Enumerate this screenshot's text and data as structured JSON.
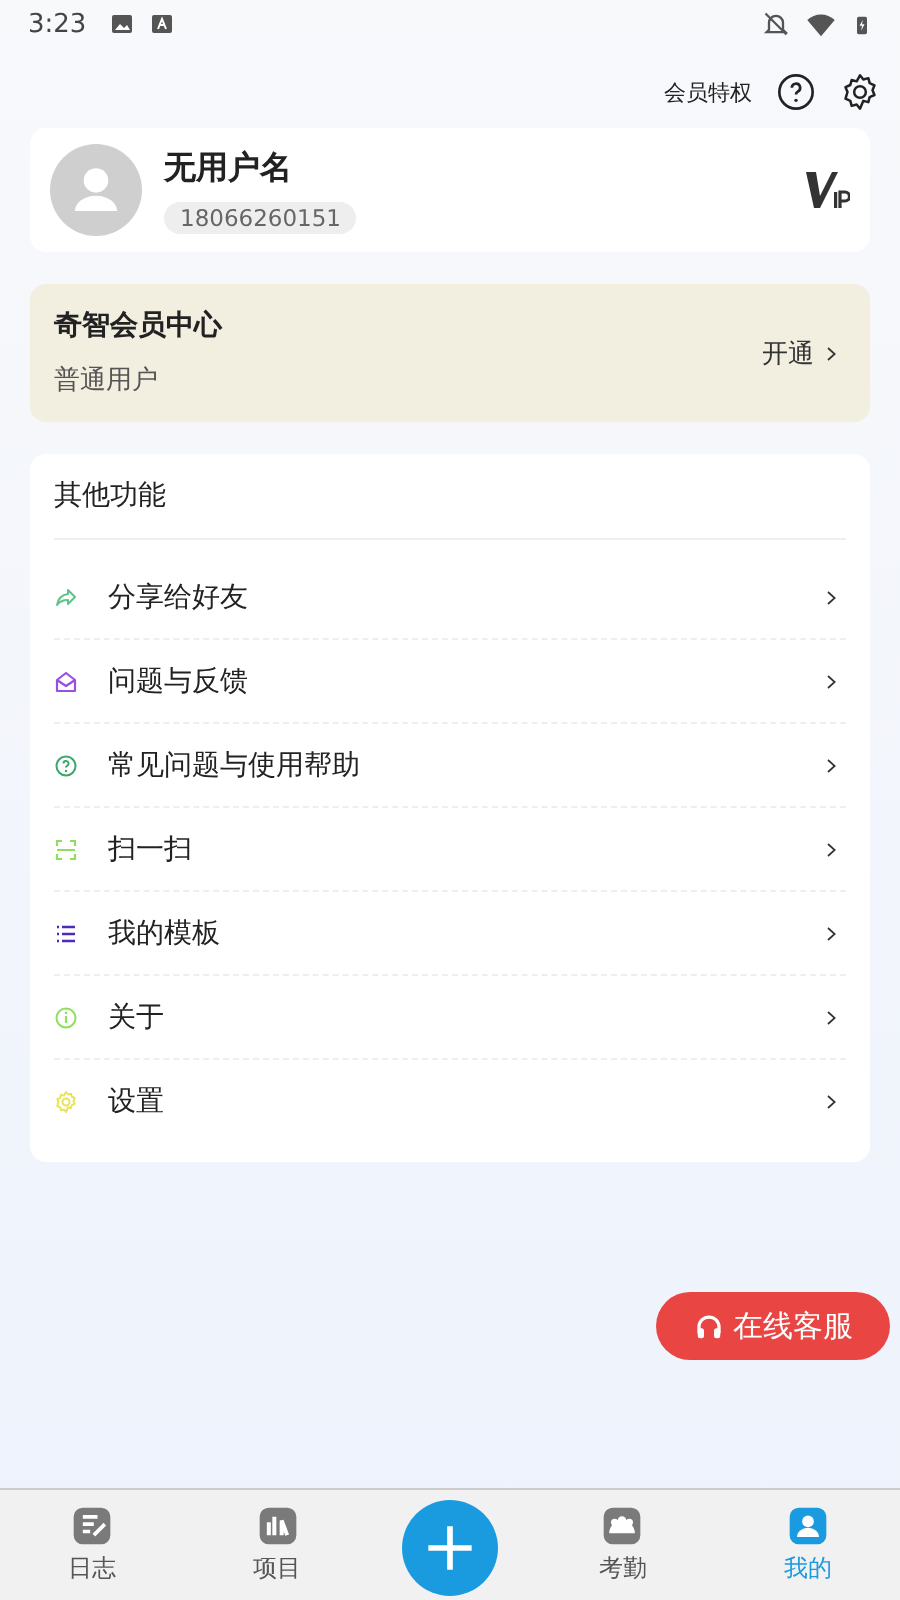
{
  "status_bar": {
    "time": "3:23"
  },
  "header": {
    "privileges": "会员特权"
  },
  "profile": {
    "name": "无用户名",
    "phone": "18066260151"
  },
  "membership": {
    "title": "奇智会员中心",
    "level": "普通用户",
    "action": "开通"
  },
  "features": {
    "title": "其他功能",
    "items": [
      {
        "label": "分享给好友",
        "kind": "share",
        "color": "#5ec48a"
      },
      {
        "label": "问题与反馈",
        "kind": "feedback",
        "color": "#9b4fe0"
      },
      {
        "label": "常见问题与使用帮助",
        "kind": "help",
        "color": "#3aa76d"
      },
      {
        "label": "扫一扫",
        "kind": "scan",
        "color": "#8ee05a"
      },
      {
        "label": "我的模板",
        "kind": "list",
        "color": "#4b2bb8"
      },
      {
        "label": "关于",
        "kind": "info",
        "color": "#8ee05a"
      },
      {
        "label": "设置",
        "kind": "settings",
        "color": "#e8e35a"
      }
    ]
  },
  "support_button": "在线客服",
  "nav": [
    {
      "label": "日志",
      "kind": "log",
      "selected": false
    },
    {
      "label": "项目",
      "kind": "project",
      "selected": false
    },
    {
      "kind": "add"
    },
    {
      "label": "考勤",
      "kind": "attendance",
      "selected": false
    },
    {
      "label": "我的",
      "kind": "me",
      "selected": true
    }
  ]
}
